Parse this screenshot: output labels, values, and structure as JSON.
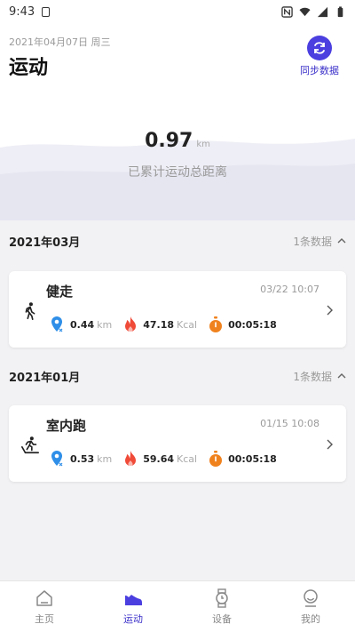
{
  "status_bar": {
    "time": "9:43"
  },
  "header": {
    "date": "2021年04月07日 周三",
    "title": "运动",
    "sync_label": "同步数据"
  },
  "summary": {
    "total_distance": "0.97",
    "unit": "km",
    "label": "已累计运动总距离"
  },
  "sections": [
    {
      "month": "2021年03月",
      "count": "1条数据",
      "record": {
        "name": "健走",
        "datetime": "03/22 10:07",
        "distance": "0.44",
        "distance_unit": "km",
        "calories": "47.18",
        "calories_unit": "Kcal",
        "duration": "00:05:18"
      }
    },
    {
      "month": "2021年01月",
      "count": "1条数据",
      "record": {
        "name": "室内跑",
        "datetime": "01/15 10:08",
        "distance": "0.53",
        "distance_unit": "km",
        "calories": "59.64",
        "calories_unit": "Kcal",
        "duration": "00:05:18"
      }
    }
  ],
  "tabs": [
    {
      "label": "主页",
      "icon": "home-icon"
    },
    {
      "label": "运动",
      "icon": "sneaker-icon",
      "active": true
    },
    {
      "label": "设备",
      "icon": "watch-icon"
    },
    {
      "label": "我的",
      "icon": "profile-icon"
    }
  ],
  "colors": {
    "accent": "#4b3fe0",
    "location": "#2f8fe8",
    "calories": "#f04a38",
    "timer": "#f0821e"
  }
}
